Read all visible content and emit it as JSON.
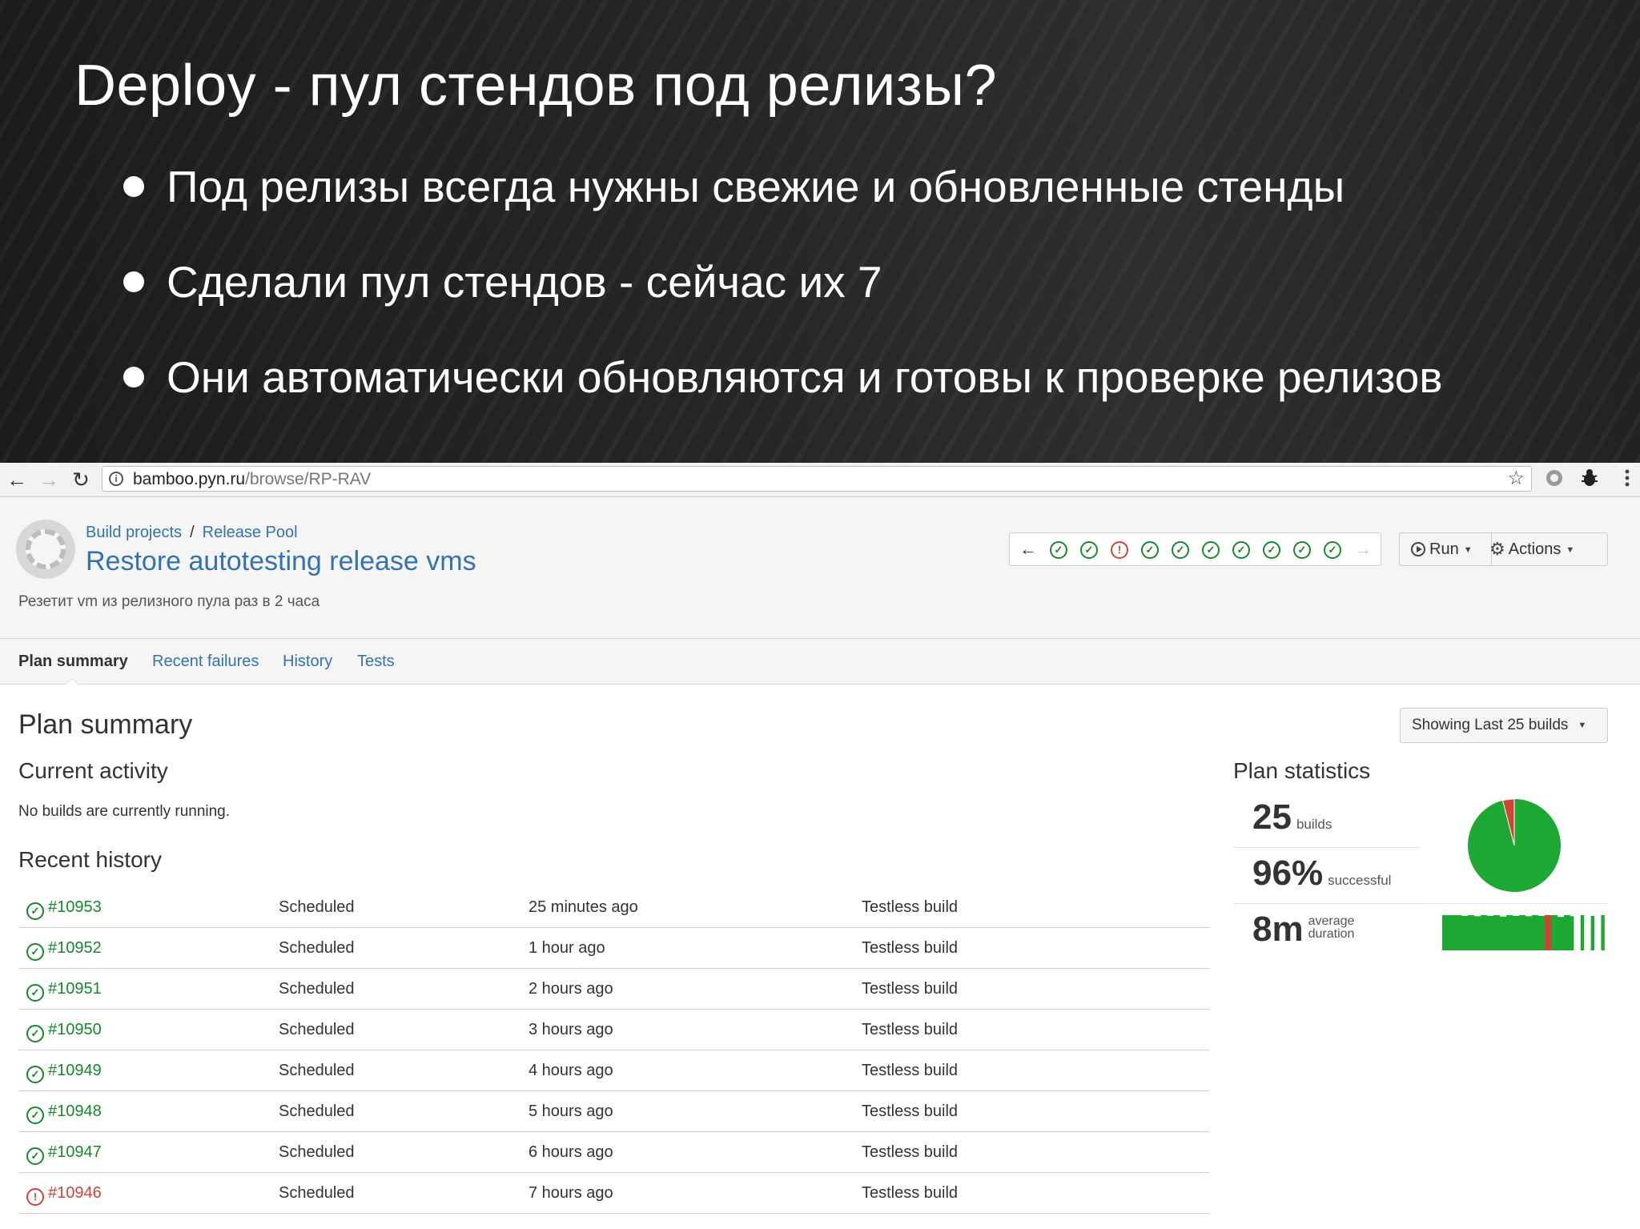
{
  "slide": {
    "title": "Deploy - пул стендов под релизы?",
    "bullets": [
      "Под релизы всегда нужны свежие и обновленные стенды",
      "Сделали пул стендов - сейчас их 7",
      "Они автоматически обновляются и готовы к проверке релизов"
    ]
  },
  "browser": {
    "url_host": "bamboo.pyn.ru",
    "url_path": "/browse/RP-RAV",
    "icons": {
      "back": "arrow-left-icon",
      "forward": "arrow-right-icon",
      "reload": "reload-icon",
      "info": "info-icon",
      "bookmark": "star-icon",
      "extension_1": "circle-extension-icon",
      "extension_2": "bug-extension-icon",
      "menu": "kebab-menu-icon"
    }
  },
  "plan": {
    "breadcrumb": [
      "Build projects",
      "Release Pool"
    ],
    "breadcrumb_separator": "/",
    "name": "Restore autotesting release vms",
    "description": "Резетит vm из релизного пула раз в 2 часа",
    "recent_build_statuses": [
      "success",
      "success",
      "failed",
      "success",
      "success",
      "success",
      "success",
      "success",
      "success",
      "success"
    ],
    "run_label": "Run",
    "actions_label": "Actions"
  },
  "tabs": [
    {
      "label": "Plan summary",
      "active": true
    },
    {
      "label": "Recent failures",
      "active": false
    },
    {
      "label": "History",
      "active": false
    },
    {
      "label": "Tests",
      "active": false
    }
  ],
  "summary": {
    "title": "Plan summary",
    "showing_label": "Showing Last 25 builds",
    "current_activity_title": "Current activity",
    "current_activity_text": "No builds are currently running.",
    "recent_history_title": "Recent history",
    "history": [
      {
        "number": "#10953",
        "status": "success",
        "reason": "Scheduled",
        "time": "25 minutes ago",
        "description": "Testless build"
      },
      {
        "number": "#10952",
        "status": "success",
        "reason": "Scheduled",
        "time": "1 hour ago",
        "description": "Testless build"
      },
      {
        "number": "#10951",
        "status": "success",
        "reason": "Scheduled",
        "time": "2 hours ago",
        "description": "Testless build"
      },
      {
        "number": "#10950",
        "status": "success",
        "reason": "Scheduled",
        "time": "3 hours ago",
        "description": "Testless build"
      },
      {
        "number": "#10949",
        "status": "success",
        "reason": "Scheduled",
        "time": "4 hours ago",
        "description": "Testless build"
      },
      {
        "number": "#10948",
        "status": "success",
        "reason": "Scheduled",
        "time": "5 hours ago",
        "description": "Testless build"
      },
      {
        "number": "#10947",
        "status": "success",
        "reason": "Scheduled",
        "time": "6 hours ago",
        "description": "Testless build"
      },
      {
        "number": "#10946",
        "status": "failed",
        "reason": "Scheduled",
        "time": "7 hours ago",
        "description": "Testless build"
      }
    ]
  },
  "statistics": {
    "title": "Plan statistics",
    "builds_value": "25",
    "builds_label": "builds",
    "success_value": "96%",
    "success_label": "successful",
    "duration_value": "8m",
    "duration_label_1": "average",
    "duration_label_2": "duration",
    "success_fraction": 0.96,
    "duration_bars": [
      {
        "status": "success",
        "level": 1.0
      },
      {
        "status": "success",
        "level": 1.0
      },
      {
        "status": "success",
        "level": 1.0
      },
      {
        "status": "success",
        "level": 0.98
      },
      {
        "status": "success",
        "level": 1.0
      },
      {
        "status": "success",
        "level": 0.97
      },
      {
        "status": "success",
        "level": 1.0
      },
      {
        "status": "success",
        "level": 0.98
      },
      {
        "status": "success",
        "level": 1.0
      },
      {
        "status": "success",
        "level": 0.96
      },
      {
        "status": "success",
        "level": 1.0
      },
      {
        "status": "success",
        "level": 0.98
      },
      {
        "status": "success",
        "level": 1.0
      },
      {
        "status": "success",
        "level": 0.97
      },
      {
        "status": "success",
        "level": 1.0
      },
      {
        "status": "success",
        "level": 0.98
      },
      {
        "status": "failed",
        "level": 1.0
      },
      {
        "status": "success",
        "level": 1.0
      },
      {
        "status": "success",
        "level": 0.95
      },
      {
        "status": "success",
        "level": 1.0
      },
      {
        "status": "success",
        "level": 0.97
      },
      {
        "status": "success",
        "level": 1.0
      },
      {
        "status": "success",
        "level": 0.98
      },
      {
        "status": "success",
        "level": 1.0
      },
      {
        "status": "success",
        "level": 0.96
      }
    ]
  },
  "colors": {
    "success": "#14892c",
    "success_fill": "#1ca832",
    "failed": "#d04437",
    "link": "#3572b0"
  }
}
